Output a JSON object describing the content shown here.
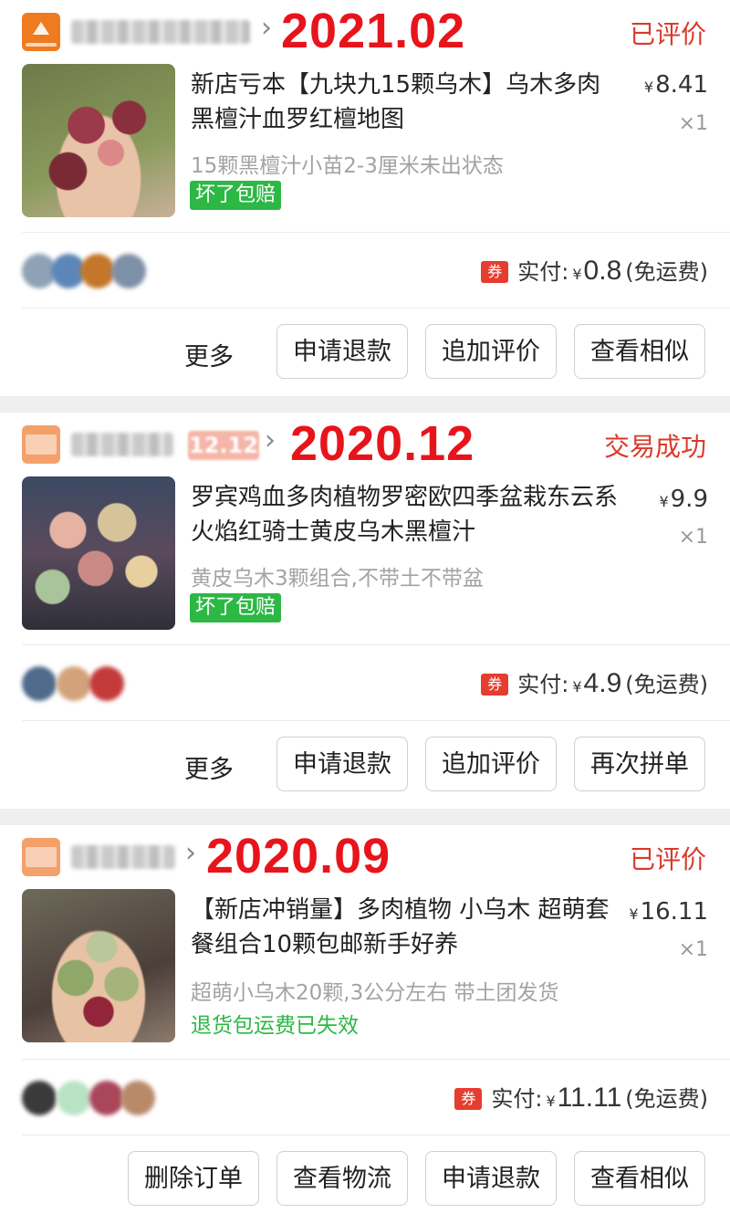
{
  "orders": [
    {
      "store_name": "",
      "date": "2021.02",
      "status": "已评价",
      "title": "新店亏本【九块九15颗乌木】乌木多肉黑檀汁血罗红檀地图",
      "price": "8.41",
      "currency": "¥",
      "quantity": "×1",
      "spec": "15颗黑檀汁小苗2-3厘米未出状态",
      "badge": "坏了包赔",
      "paid_label": "实付:",
      "paid_amount": "0.8",
      "shipping": "(免运费)",
      "coupon": "券",
      "buttons": [
        "更多",
        "申请退款",
        "追加评价",
        "查看相似"
      ]
    },
    {
      "store_name": "",
      "store_tag": "12.12",
      "date": "2020.12",
      "status": "交易成功",
      "title": "罗宾鸡血多肉植物罗密欧四季盆栽东云系火焰红骑士黄皮乌木黑檀汁",
      "price": "9.9",
      "currency": "¥",
      "quantity": "×1",
      "spec": "黄皮乌木3颗组合,不带土不带盆",
      "badge": "坏了包赔",
      "paid_label": "实付:",
      "paid_amount": "4.9",
      "shipping": "(免运费)",
      "coupon": "券",
      "buttons": [
        "更多",
        "申请退款",
        "追加评价",
        "再次拼单"
      ]
    },
    {
      "store_name": "",
      "date": "2020.09",
      "status": "已评价",
      "title": "【新店冲销量】多肉植物 小乌木 超萌套餐组合10颗包邮新手好养",
      "price": "16.11",
      "currency": "¥",
      "quantity": "×1",
      "spec": "超萌小乌木20颗,3公分左右 带土团发货",
      "notice": "退货包运费已失效",
      "paid_label": "实付:",
      "paid_amount": "11.11",
      "shipping": "(免运费)",
      "coupon": "券",
      "buttons": [
        "删除订单",
        "查看物流",
        "申请退款",
        "查看相似"
      ]
    }
  ],
  "colors": {
    "date_red": "#e8141c",
    "status_red": "#d93a2b",
    "green": "#2db845",
    "coupon_red": "#e53d30"
  },
  "icons": [
    "store-logo-icon",
    "chevron-right-icon",
    "coupon-icon"
  ]
}
